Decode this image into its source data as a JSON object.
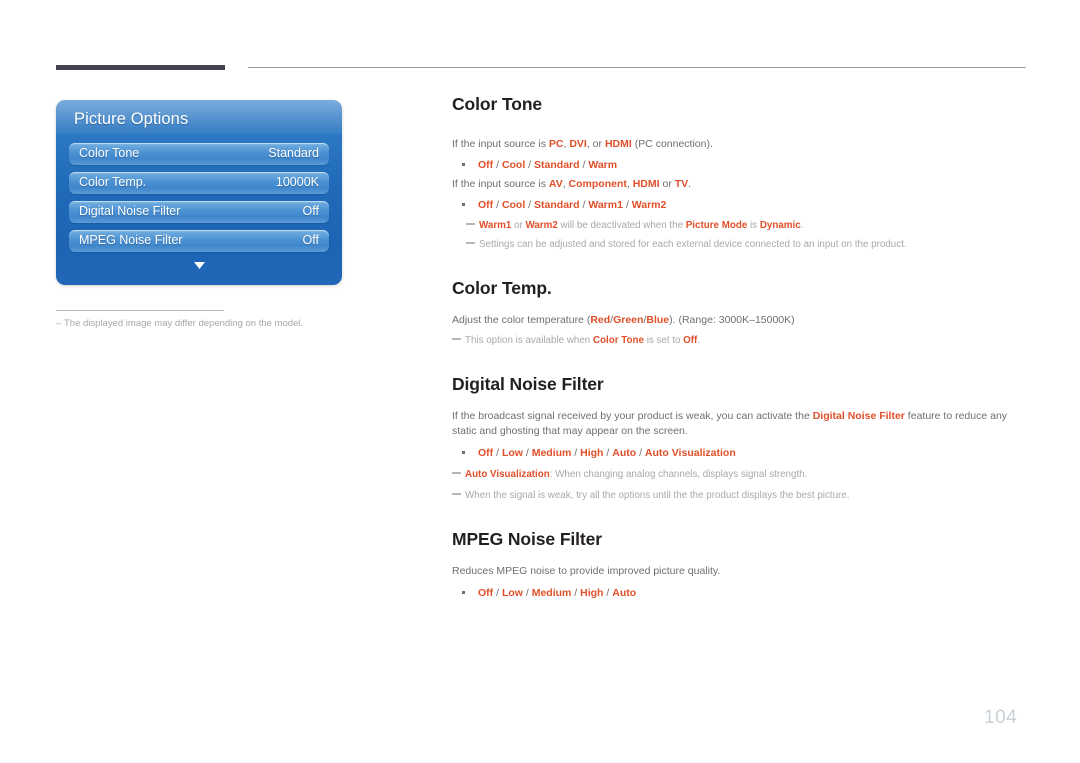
{
  "page": {
    "number": "104"
  },
  "osd": {
    "title": "Picture Options",
    "rows": [
      {
        "label": "Color Tone",
        "value": "Standard"
      },
      {
        "label": "Color Temp.",
        "value": "10000K"
      },
      {
        "label": "Digital Noise Filter",
        "value": "Off"
      },
      {
        "label": "MPEG Noise Filter",
        "value": "Off"
      }
    ],
    "scroll_icon": "chevron-down-icon",
    "footnote": "The displayed image may differ depending on the model.",
    "footnote_dash": "–"
  },
  "colors": {
    "accent": "#e0502a",
    "body_text": "#6f6f74",
    "heading": "#231f20",
    "note_text": "#a9a9ae",
    "page_number": "#c9d2d8",
    "osd_panel_blue": "#1f6ab9",
    "osd_row_blue": "#4a90d2",
    "rule_dark": "#454050"
  },
  "sections": [
    {
      "id": "color-tone",
      "title": "Color Tone",
      "intro1_pre": "If the input source is ",
      "intro1_a": "PC",
      "intro1_sep1": ", ",
      "intro1_b": "DVI",
      "intro1_sep2": ", or ",
      "intro1_c": "HDMI",
      "intro1_post": " (PC connection).",
      "options1": "Off / Cool / Standard / Warm",
      "intro2_pre": "If the input source is ",
      "intro2_a": "AV",
      "intro2_sep1": ", ",
      "intro2_b": "Component",
      "intro2_sep2": ", ",
      "intro2_c": "HDMI",
      "intro2_sep3": " or ",
      "intro2_d": "TV",
      "intro2_post": ".",
      "options2": "Off / Cool / Standard / Warm1 / Warm2",
      "note1_a": "Warm1",
      "note1_b": " or ",
      "note1_c": "Warm2",
      "note1_d": " will be deactivated when the ",
      "note1_e": "Picture Mode",
      "note1_f": " is ",
      "note1_g": "Dynamic",
      "note1_h": ".",
      "note2": "Settings can be adjusted and stored for each external device connected to an input on the product."
    },
    {
      "id": "color-temp",
      "title": "Color Temp.",
      "intro_pre": "Adjust the color temperature (",
      "intro_a": "Red/Green/Blue",
      "intro_post": "). (Range: 3000K–15000K)",
      "note1_a": "This option is available when ",
      "note1_b": "Color Tone",
      "note1_c": " is set to ",
      "note1_d": "Off",
      "note1_e": "."
    },
    {
      "id": "digital-noise-filter",
      "title": "Digital Noise Filter",
      "intro_pre": "If the broadcast signal received by your product is weak, you can activate the ",
      "intro_a": "Digital Noise Filter",
      "intro_post": " feature to reduce any static and ghosting that may appear on the screen.",
      "options": "Off / Low / Medium / High / Auto / Auto Visualization",
      "note1_a": "Auto Visualization",
      "note1_b": ": When changing analog channels, displays signal strength.",
      "note2": "When the signal is weak, try all the options until the the product displays the best picture."
    },
    {
      "id": "mpeg-noise-filter",
      "title": "MPEG Noise Filter",
      "intro": "Reduces MPEG noise to provide improved picture quality.",
      "options": "Off / Low / Medium / High / Auto"
    }
  ]
}
